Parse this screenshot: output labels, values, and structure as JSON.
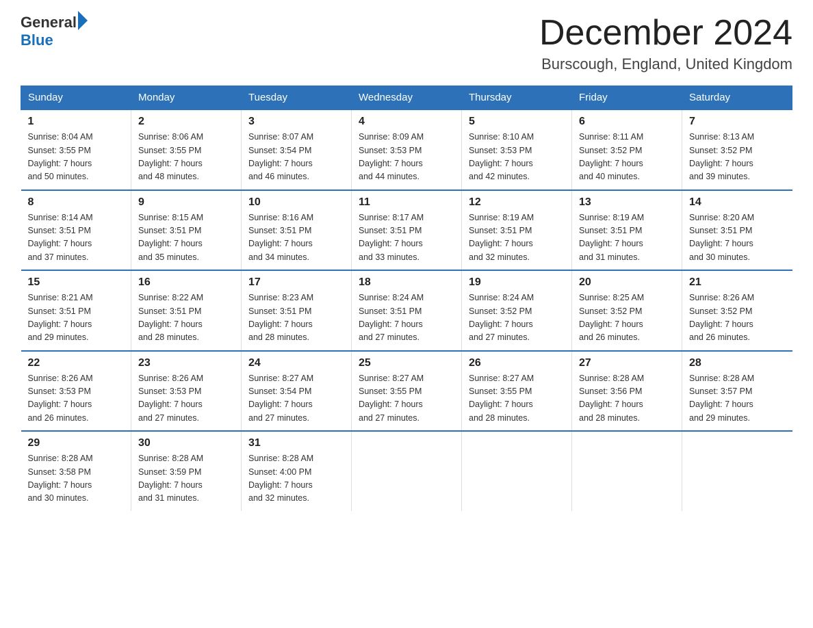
{
  "header": {
    "logo_general": "General",
    "logo_blue": "Blue",
    "month_title": "December 2024",
    "location": "Burscough, England, United Kingdom"
  },
  "days_of_week": [
    "Sunday",
    "Monday",
    "Tuesday",
    "Wednesday",
    "Thursday",
    "Friday",
    "Saturday"
  ],
  "weeks": [
    [
      {
        "day": "1",
        "sunrise": "8:04 AM",
        "sunset": "3:55 PM",
        "daylight": "7 hours and 50 minutes."
      },
      {
        "day": "2",
        "sunrise": "8:06 AM",
        "sunset": "3:55 PM",
        "daylight": "7 hours and 48 minutes."
      },
      {
        "day": "3",
        "sunrise": "8:07 AM",
        "sunset": "3:54 PM",
        "daylight": "7 hours and 46 minutes."
      },
      {
        "day": "4",
        "sunrise": "8:09 AM",
        "sunset": "3:53 PM",
        "daylight": "7 hours and 44 minutes."
      },
      {
        "day": "5",
        "sunrise": "8:10 AM",
        "sunset": "3:53 PM",
        "daylight": "7 hours and 42 minutes."
      },
      {
        "day": "6",
        "sunrise": "8:11 AM",
        "sunset": "3:52 PM",
        "daylight": "7 hours and 40 minutes."
      },
      {
        "day": "7",
        "sunrise": "8:13 AM",
        "sunset": "3:52 PM",
        "daylight": "7 hours and 39 minutes."
      }
    ],
    [
      {
        "day": "8",
        "sunrise": "8:14 AM",
        "sunset": "3:51 PM",
        "daylight": "7 hours and 37 minutes."
      },
      {
        "day": "9",
        "sunrise": "8:15 AM",
        "sunset": "3:51 PM",
        "daylight": "7 hours and 35 minutes."
      },
      {
        "day": "10",
        "sunrise": "8:16 AM",
        "sunset": "3:51 PM",
        "daylight": "7 hours and 34 minutes."
      },
      {
        "day": "11",
        "sunrise": "8:17 AM",
        "sunset": "3:51 PM",
        "daylight": "7 hours and 33 minutes."
      },
      {
        "day": "12",
        "sunrise": "8:19 AM",
        "sunset": "3:51 PM",
        "daylight": "7 hours and 32 minutes."
      },
      {
        "day": "13",
        "sunrise": "8:19 AM",
        "sunset": "3:51 PM",
        "daylight": "7 hours and 31 minutes."
      },
      {
        "day": "14",
        "sunrise": "8:20 AM",
        "sunset": "3:51 PM",
        "daylight": "7 hours and 30 minutes."
      }
    ],
    [
      {
        "day": "15",
        "sunrise": "8:21 AM",
        "sunset": "3:51 PM",
        "daylight": "7 hours and 29 minutes."
      },
      {
        "day": "16",
        "sunrise": "8:22 AM",
        "sunset": "3:51 PM",
        "daylight": "7 hours and 28 minutes."
      },
      {
        "day": "17",
        "sunrise": "8:23 AM",
        "sunset": "3:51 PM",
        "daylight": "7 hours and 28 minutes."
      },
      {
        "day": "18",
        "sunrise": "8:24 AM",
        "sunset": "3:51 PM",
        "daylight": "7 hours and 27 minutes."
      },
      {
        "day": "19",
        "sunrise": "8:24 AM",
        "sunset": "3:52 PM",
        "daylight": "7 hours and 27 minutes."
      },
      {
        "day": "20",
        "sunrise": "8:25 AM",
        "sunset": "3:52 PM",
        "daylight": "7 hours and 26 minutes."
      },
      {
        "day": "21",
        "sunrise": "8:26 AM",
        "sunset": "3:52 PM",
        "daylight": "7 hours and 26 minutes."
      }
    ],
    [
      {
        "day": "22",
        "sunrise": "8:26 AM",
        "sunset": "3:53 PM",
        "daylight": "7 hours and 26 minutes."
      },
      {
        "day": "23",
        "sunrise": "8:26 AM",
        "sunset": "3:53 PM",
        "daylight": "7 hours and 27 minutes."
      },
      {
        "day": "24",
        "sunrise": "8:27 AM",
        "sunset": "3:54 PM",
        "daylight": "7 hours and 27 minutes."
      },
      {
        "day": "25",
        "sunrise": "8:27 AM",
        "sunset": "3:55 PM",
        "daylight": "7 hours and 27 minutes."
      },
      {
        "day": "26",
        "sunrise": "8:27 AM",
        "sunset": "3:55 PM",
        "daylight": "7 hours and 28 minutes."
      },
      {
        "day": "27",
        "sunrise": "8:28 AM",
        "sunset": "3:56 PM",
        "daylight": "7 hours and 28 minutes."
      },
      {
        "day": "28",
        "sunrise": "8:28 AM",
        "sunset": "3:57 PM",
        "daylight": "7 hours and 29 minutes."
      }
    ],
    [
      {
        "day": "29",
        "sunrise": "8:28 AM",
        "sunset": "3:58 PM",
        "daylight": "7 hours and 30 minutes."
      },
      {
        "day": "30",
        "sunrise": "8:28 AM",
        "sunset": "3:59 PM",
        "daylight": "7 hours and 31 minutes."
      },
      {
        "day": "31",
        "sunrise": "8:28 AM",
        "sunset": "4:00 PM",
        "daylight": "7 hours and 32 minutes."
      },
      null,
      null,
      null,
      null
    ]
  ],
  "sunrise_label": "Sunrise: ",
  "sunset_label": "Sunset: ",
  "daylight_label": "Daylight: "
}
